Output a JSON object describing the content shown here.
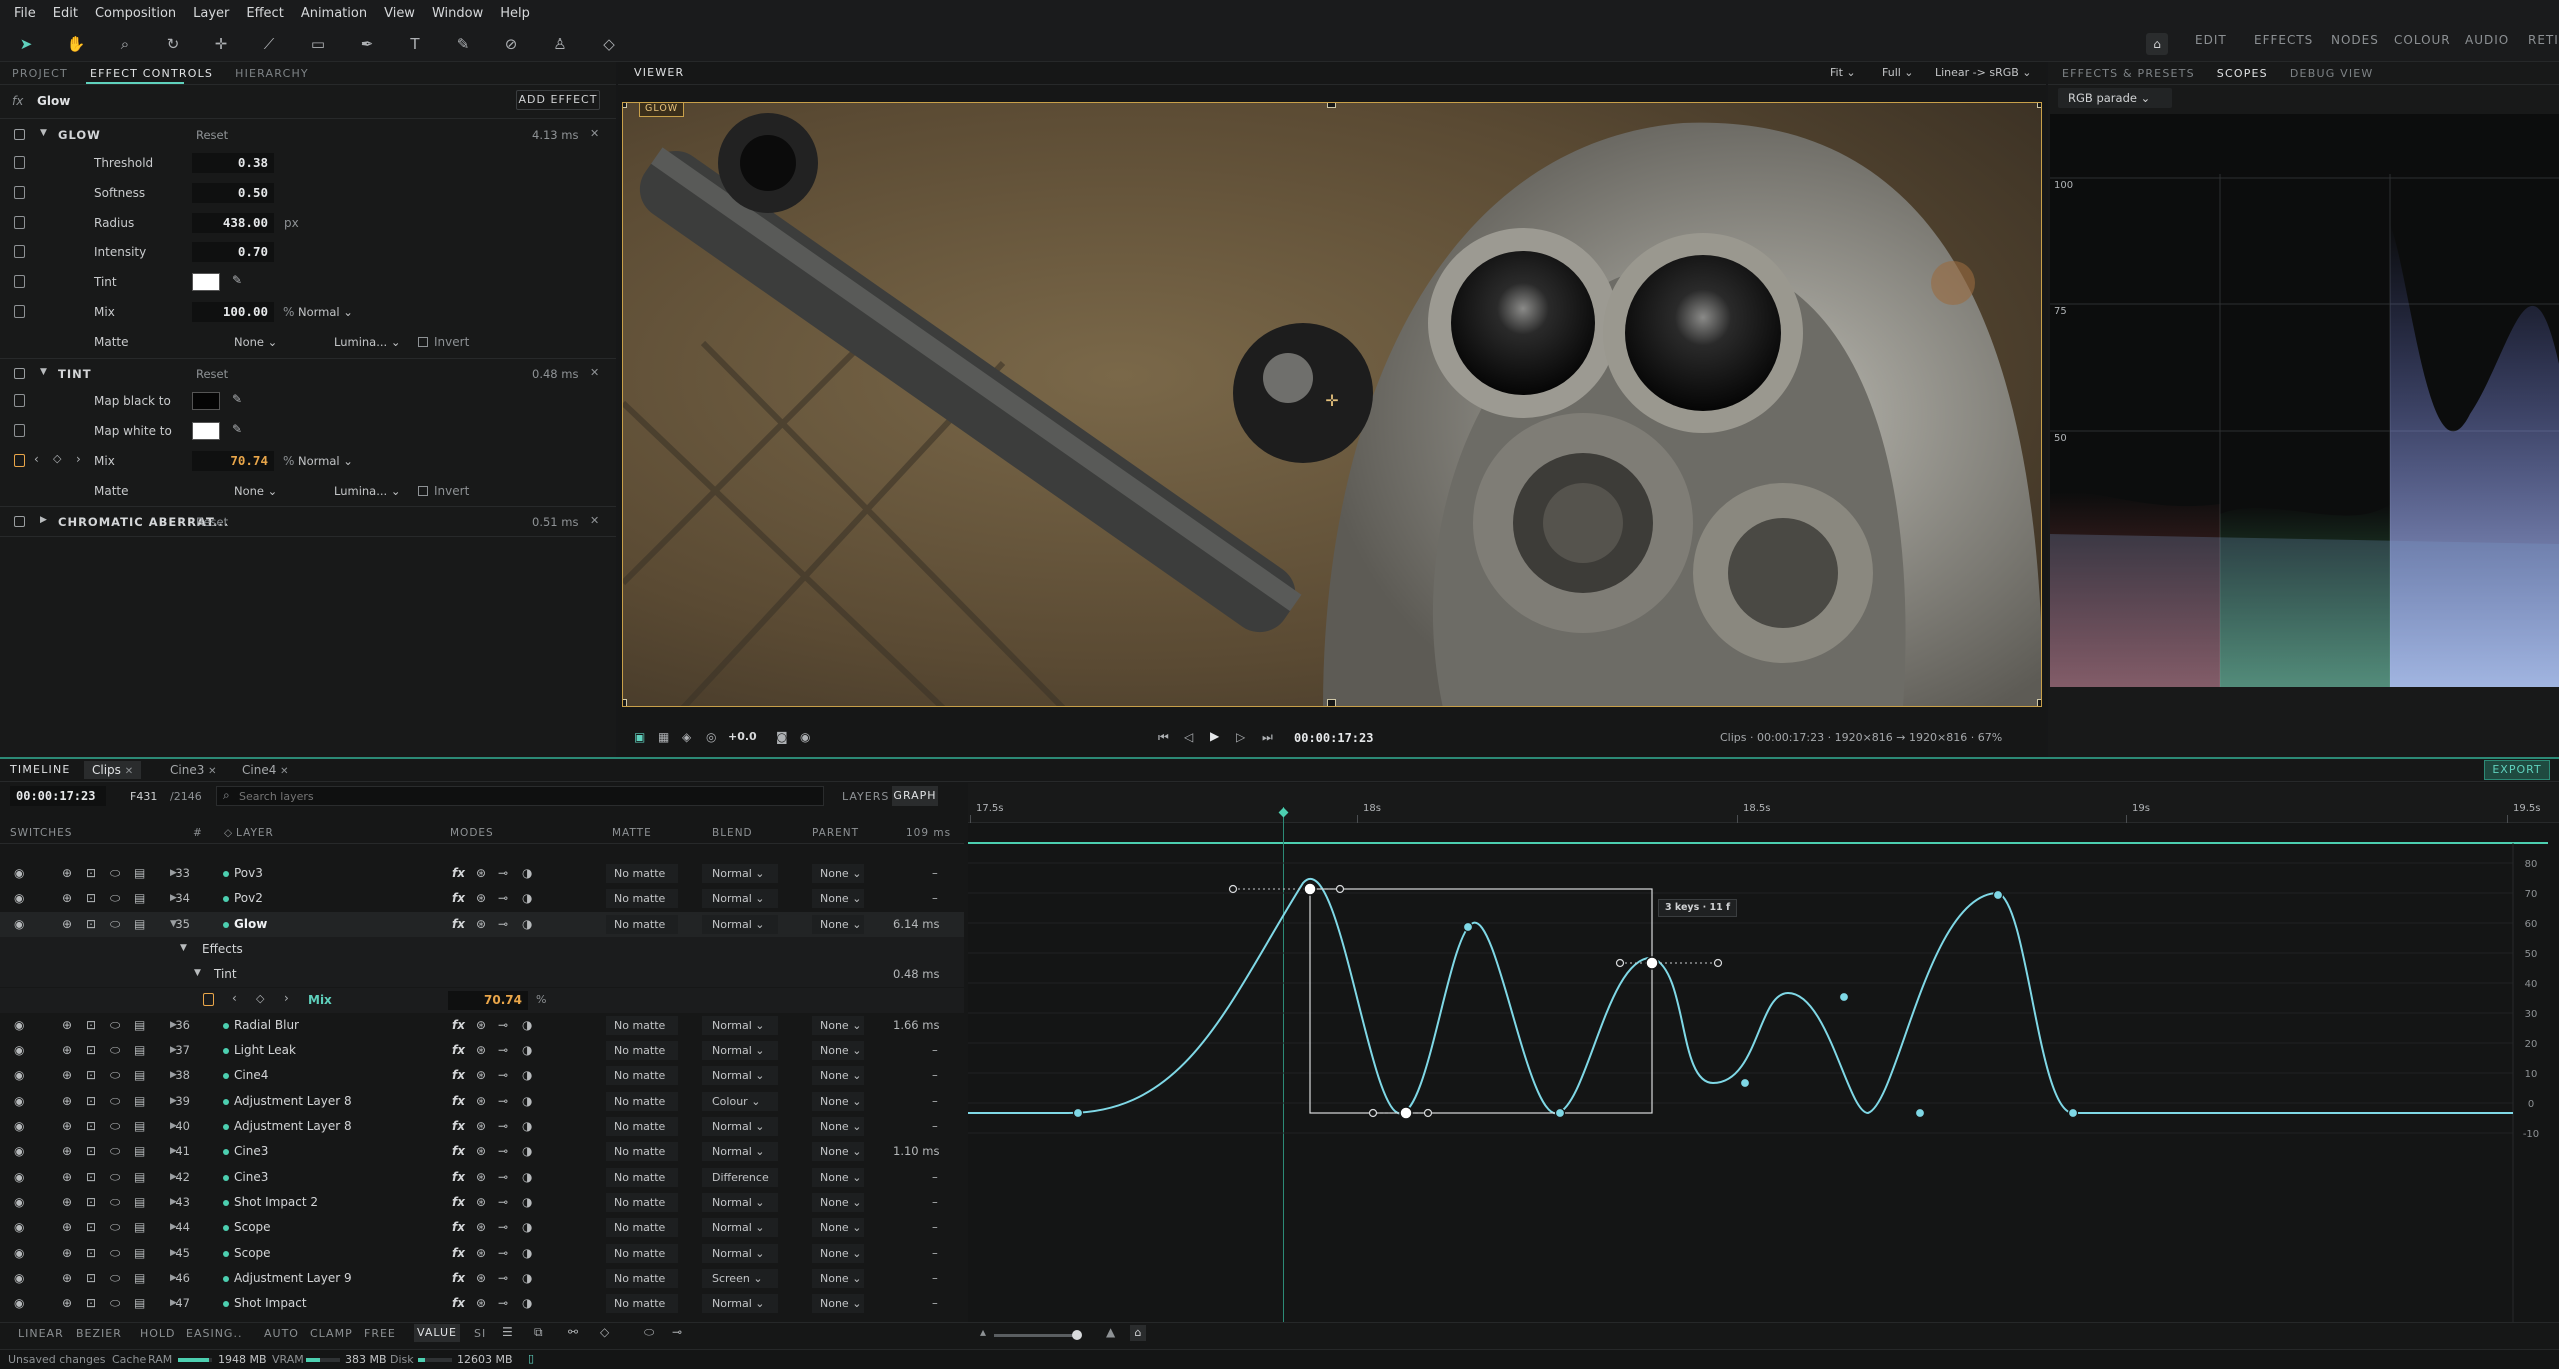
{
  "menu": [
    "File",
    "Edit",
    "Composition",
    "Layer",
    "Effect",
    "Animation",
    "View",
    "Window",
    "Help"
  ],
  "workspaces": [
    "EDIT",
    "EFFECTS",
    "NODES",
    "COLOUR",
    "AUDIO",
    "RETIMING"
  ],
  "left_tabs": [
    "PROJECT",
    "EFFECT CONTROLS",
    "HIERARCHY"
  ],
  "effect_controls": {
    "fx_label": "fx",
    "layer_name": "Glow",
    "add_effect": "ADD EFFECT",
    "glow": {
      "name": "GLOW",
      "reset": "Reset",
      "ms": "4.13 ms",
      "threshold_label": "Threshold",
      "threshold": "0.38",
      "softness_label": "Softness",
      "softness": "0.50",
      "radius_label": "Radius",
      "radius": "438.00",
      "radius_unit": "px",
      "intensity_label": "Intensity",
      "intensity": "0.70",
      "tint_label": "Tint",
      "mix_label": "Mix",
      "mix": "100.00",
      "mix_unit": "%",
      "mix_mode": "Normal",
      "matte_label": "Matte",
      "matte": "None",
      "matte_type": "Lumina...",
      "invert": "Invert"
    },
    "tint": {
      "name": "TINT",
      "reset": "Reset",
      "ms": "0.48 ms",
      "map_black_label": "Map black to",
      "map_white_label": "Map white to",
      "mix_label": "Mix",
      "mix": "70.74",
      "mix_unit": "%",
      "mix_mode": "Normal",
      "matte_label": "Matte",
      "matte": "None",
      "matte_type": "Lumina...",
      "invert": "Invert"
    },
    "chromatic": {
      "name": "CHROMATIC ABERRAT...",
      "reset": "Reset",
      "ms": "0.51 ms"
    }
  },
  "viewer": {
    "tab": "VIEWER",
    "fit": "Fit",
    "quality": "Full",
    "color": "Linear -> sRGB",
    "badge": "GLOW",
    "exposure": "+0.0",
    "timecode": "00:00:17:23",
    "info": "Clips · 00:00:17:23 · 1920×816 → 1920×816 · 67%"
  },
  "right_tabs": [
    "EFFECTS & PRESETS",
    "SCOPES",
    "DEBUG VIEW"
  ],
  "scopes": {
    "mode": "RGB parade",
    "ticks": [
      "100",
      "75",
      "50"
    ]
  },
  "timeline": {
    "tab": "TIMELINE",
    "comp_tabs": [
      "Clips",
      "Cine3",
      "Cine4"
    ],
    "export": "EXPORT",
    "timecode": "00:00:17:23",
    "frame": "F431",
    "total": "/2146",
    "search_placeholder": "Search layers",
    "view_layers": "LAYERS",
    "view_graph": "GRAPH",
    "cols": {
      "switches": "SWITCHES",
      "num": "#",
      "layer": "LAYER",
      "modes": "MODES",
      "matte": "MATTE",
      "blend": "BLEND",
      "parent": "PARENT",
      "ms": "109 ms"
    },
    "effects_label": "Effects",
    "tint_label": "Tint",
    "tint_ms": "0.48 ms",
    "mix_label": "Mix",
    "mix_value": "70.74",
    "mix_unit": "%",
    "fx": "fx",
    "layers": [
      {
        "num": "33",
        "name": "Pov3",
        "matte": "No matte",
        "blend": "Normal",
        "parent": "None",
        "ms": "–"
      },
      {
        "num": "34",
        "name": "Pov2",
        "matte": "No matte",
        "blend": "Normal",
        "parent": "None",
        "ms": "–"
      },
      {
        "num": "35",
        "name": "Glow",
        "matte": "No matte",
        "blend": "Normal",
        "parent": "None",
        "ms": "6.14 ms"
      },
      {
        "num": "36",
        "name": "Radial Blur",
        "matte": "No matte",
        "blend": "Normal",
        "parent": "None",
        "ms": "1.66 ms"
      },
      {
        "num": "37",
        "name": "Light Leak",
        "matte": "No matte",
        "blend": "Normal",
        "parent": "None",
        "ms": "–"
      },
      {
        "num": "38",
        "name": "Cine4",
        "matte": "No matte",
        "blend": "Normal",
        "parent": "None",
        "ms": "–"
      },
      {
        "num": "39",
        "name": "Adjustment Layer 8",
        "matte": "No matte",
        "blend": "Colour",
        "parent": "None",
        "ms": "–"
      },
      {
        "num": "40",
        "name": "Adjustment Layer 8",
        "matte": "No matte",
        "blend": "Normal",
        "parent": "None",
        "ms": "–"
      },
      {
        "num": "41",
        "name": "Cine3",
        "matte": "No matte",
        "blend": "Normal",
        "parent": "None",
        "ms": "1.10 ms"
      },
      {
        "num": "42",
        "name": "Cine3",
        "matte": "No matte",
        "blend": "Difference",
        "parent": "None",
        "ms": "–"
      },
      {
        "num": "43",
        "name": "Shot Impact 2",
        "matte": "No matte",
        "blend": "Normal",
        "parent": "None",
        "ms": "–"
      },
      {
        "num": "44",
        "name": "Scope",
        "matte": "No matte",
        "blend": "Normal",
        "parent": "None",
        "ms": "–"
      },
      {
        "num": "45",
        "name": "Scope",
        "matte": "No matte",
        "blend": "Normal",
        "parent": "None",
        "ms": "–"
      },
      {
        "num": "46",
        "name": "Adjustment Layer 9",
        "matte": "No matte",
        "blend": "Screen",
        "parent": "None",
        "ms": "–"
      },
      {
        "num": "47",
        "name": "Shot Impact",
        "matte": "No matte",
        "blend": "Normal",
        "parent": "None",
        "ms": "–"
      }
    ],
    "ruler": [
      "17.5s",
      "18s",
      "18.5s",
      "19s",
      "19.5s"
    ],
    "graph_y": [
      "80",
      "70",
      "60",
      "50",
      "40",
      "30",
      "20",
      "10",
      "0",
      "-10"
    ],
    "keys_tooltip": "3 keys · 11 f",
    "interp": [
      "LINEAR",
      "BEZIER",
      "HOLD",
      "EASING..",
      "AUTO",
      "CLAMP",
      "FREE",
      "VALUE",
      "SI"
    ]
  },
  "status": {
    "unsaved": "Unsaved changes",
    "cache": "Cache",
    "ram": "RAM",
    "ram_val": "1948 MB",
    "vram": "VRAM",
    "vram_val": "383 MB",
    "disk": "Disk",
    "disk_val": "12603 MB"
  }
}
